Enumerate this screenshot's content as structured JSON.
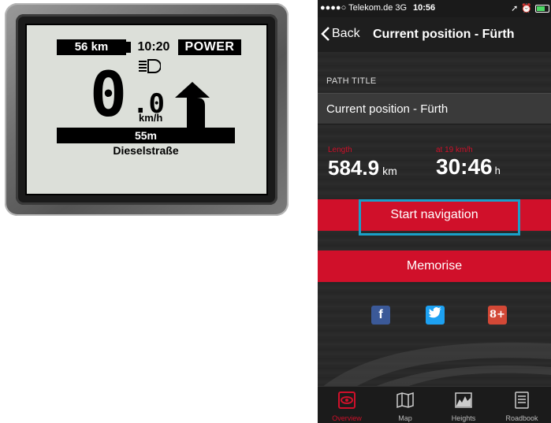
{
  "display": {
    "distance": "56 km",
    "time": "10:20",
    "mode": "POWER",
    "speed_int": "0",
    "speed_dec": ".0",
    "speed_unit": "km/h",
    "next_turn_distance": "55m",
    "street": "Dieselstraße"
  },
  "status": {
    "carrier": "●●●●○ Telekom.de  3G",
    "time": "10:56"
  },
  "nav": {
    "back": "Back",
    "title": "Current position - Fürth"
  },
  "path": {
    "label": "PATH TITLE",
    "value": "Current position - Fürth"
  },
  "stats": {
    "length_label": "Length",
    "length_value": "584.9",
    "length_unit": "km",
    "time_label": "at 19 km/h",
    "time_value": "30:46",
    "time_unit": "h"
  },
  "actions": {
    "start": "Start navigation",
    "memorise": "Memorise"
  },
  "social": {
    "facebook": "f",
    "twitter": "t",
    "googleplus": "8+"
  },
  "tabs": [
    {
      "label": "Overview",
      "icon": "eye-icon",
      "active": true
    },
    {
      "label": "Map",
      "icon": "map-icon",
      "active": false
    },
    {
      "label": "Heights",
      "icon": "heights-icon",
      "active": false
    },
    {
      "label": "Roadbook",
      "icon": "roadbook-icon",
      "active": false
    }
  ],
  "colors": {
    "accent": "#d0102a",
    "highlight": "#1aa0c8",
    "lcd": "#dcdfd9"
  }
}
